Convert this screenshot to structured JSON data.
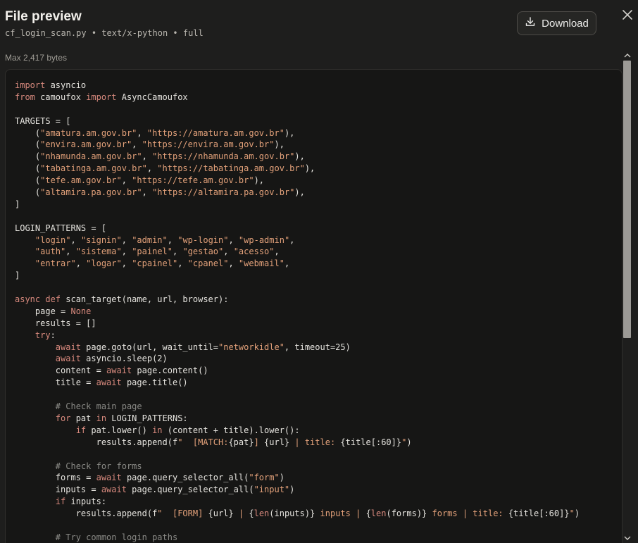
{
  "header": {
    "title": "File preview",
    "subtitle": "cf_login_scan.py • text/x-python • full",
    "download_label": "Download",
    "max_bytes": "Max 2,417 bytes"
  },
  "icons": {
    "download": "download-icon",
    "close": "close-icon"
  },
  "colors": {
    "keyword": "#d98a7e",
    "string": "#e3a17a",
    "comment": "#8a8a86",
    "text": "#e6e4df"
  },
  "code_lines": [
    [
      [
        "kw",
        "import"
      ],
      [
        "t",
        " asyncio"
      ]
    ],
    [
      [
        "kw",
        "from"
      ],
      [
        "t",
        " camoufox "
      ],
      [
        "kw",
        "import"
      ],
      [
        "t",
        " AsyncCamoufox"
      ]
    ],
    [],
    [
      [
        "t",
        "TARGETS = ["
      ]
    ],
    [
      [
        "t",
        "    ("
      ],
      [
        "str",
        "\"amatura.am.gov.br\""
      ],
      [
        "t",
        ", "
      ],
      [
        "str",
        "\"https://amatura.am.gov.br\""
      ],
      [
        "t",
        "),"
      ]
    ],
    [
      [
        "t",
        "    ("
      ],
      [
        "str",
        "\"envira.am.gov.br\""
      ],
      [
        "t",
        ", "
      ],
      [
        "str",
        "\"https://envira.am.gov.br\""
      ],
      [
        "t",
        "),"
      ]
    ],
    [
      [
        "t",
        "    ("
      ],
      [
        "str",
        "\"nhamunda.am.gov.br\""
      ],
      [
        "t",
        ", "
      ],
      [
        "str",
        "\"https://nhamunda.am.gov.br\""
      ],
      [
        "t",
        "),"
      ]
    ],
    [
      [
        "t",
        "    ("
      ],
      [
        "str",
        "\"tabatinga.am.gov.br\""
      ],
      [
        "t",
        ", "
      ],
      [
        "str",
        "\"https://tabatinga.am.gov.br\""
      ],
      [
        "t",
        "),"
      ]
    ],
    [
      [
        "t",
        "    ("
      ],
      [
        "str",
        "\"tefe.am.gov.br\""
      ],
      [
        "t",
        ", "
      ],
      [
        "str",
        "\"https://tefe.am.gov.br\""
      ],
      [
        "t",
        "),"
      ]
    ],
    [
      [
        "t",
        "    ("
      ],
      [
        "str",
        "\"altamira.pa.gov.br\""
      ],
      [
        "t",
        ", "
      ],
      [
        "str",
        "\"https://altamira.pa.gov.br\""
      ],
      [
        "t",
        "),"
      ]
    ],
    [
      [
        "t",
        "]"
      ]
    ],
    [],
    [
      [
        "t",
        "LOGIN_PATTERNS = ["
      ]
    ],
    [
      [
        "t",
        "    "
      ],
      [
        "str",
        "\"login\""
      ],
      [
        "t",
        ", "
      ],
      [
        "str",
        "\"signin\""
      ],
      [
        "t",
        ", "
      ],
      [
        "str",
        "\"admin\""
      ],
      [
        "t",
        ", "
      ],
      [
        "str",
        "\"wp-login\""
      ],
      [
        "t",
        ", "
      ],
      [
        "str",
        "\"wp-admin\""
      ],
      [
        "t",
        ","
      ]
    ],
    [
      [
        "t",
        "    "
      ],
      [
        "str",
        "\"auth\""
      ],
      [
        "t",
        ", "
      ],
      [
        "str",
        "\"sistema\""
      ],
      [
        "t",
        ", "
      ],
      [
        "str",
        "\"painel\""
      ],
      [
        "t",
        ", "
      ],
      [
        "str",
        "\"gestao\""
      ],
      [
        "t",
        ", "
      ],
      [
        "str",
        "\"acesso\""
      ],
      [
        "t",
        ","
      ]
    ],
    [
      [
        "t",
        "    "
      ],
      [
        "str",
        "\"entrar\""
      ],
      [
        "t",
        ", "
      ],
      [
        "str",
        "\"logar\""
      ],
      [
        "t",
        ", "
      ],
      [
        "str",
        "\"cpainel\""
      ],
      [
        "t",
        ", "
      ],
      [
        "str",
        "\"cpanel\""
      ],
      [
        "t",
        ", "
      ],
      [
        "str",
        "\"webmail\""
      ],
      [
        "t",
        ","
      ]
    ],
    [
      [
        "t",
        "]"
      ]
    ],
    [],
    [
      [
        "kw",
        "async def"
      ],
      [
        "t",
        " scan_target(name, url, browser):"
      ]
    ],
    [
      [
        "t",
        "    page = "
      ],
      [
        "kw",
        "None"
      ]
    ],
    [
      [
        "t",
        "    results = []"
      ]
    ],
    [
      [
        "t",
        "    "
      ],
      [
        "kw",
        "try"
      ],
      [
        "t",
        ":"
      ]
    ],
    [
      [
        "t",
        "        "
      ],
      [
        "kw",
        "await"
      ],
      [
        "t",
        " page.goto(url, wait_until="
      ],
      [
        "str",
        "\"networkidle\""
      ],
      [
        "t",
        ", timeout=25)"
      ]
    ],
    [
      [
        "t",
        "        "
      ],
      [
        "kw",
        "await"
      ],
      [
        "t",
        " asyncio.sleep(2)"
      ]
    ],
    [
      [
        "t",
        "        content = "
      ],
      [
        "kw",
        "await"
      ],
      [
        "t",
        " page.content()"
      ]
    ],
    [
      [
        "t",
        "        title = "
      ],
      [
        "kw",
        "await"
      ],
      [
        "t",
        " page.title()"
      ]
    ],
    [],
    [
      [
        "t",
        "        "
      ],
      [
        "cm",
        "# Check main page"
      ]
    ],
    [
      [
        "t",
        "        "
      ],
      [
        "kw",
        "for"
      ],
      [
        "t",
        " pat "
      ],
      [
        "kw",
        "in"
      ],
      [
        "t",
        " LOGIN_PATTERNS:"
      ]
    ],
    [
      [
        "t",
        "            "
      ],
      [
        "kw",
        "if"
      ],
      [
        "t",
        " pat.lower() "
      ],
      [
        "kw",
        "in"
      ],
      [
        "t",
        " (content + title).lower():"
      ]
    ],
    [
      [
        "t",
        "                results.append(f"
      ],
      [
        "str",
        "\"  [MATCH:"
      ],
      [
        "t",
        "{pat}"
      ],
      [
        "str",
        "] "
      ],
      [
        "t",
        "{url}"
      ],
      [
        "str",
        " | title: "
      ],
      [
        "t",
        "{title[:60]}"
      ],
      [
        "str",
        "\""
      ],
      [
        "t",
        ")"
      ]
    ],
    [],
    [
      [
        "t",
        "        "
      ],
      [
        "cm",
        "# Check for forms"
      ]
    ],
    [
      [
        "t",
        "        forms = "
      ],
      [
        "kw",
        "await"
      ],
      [
        "t",
        " page.query_selector_all("
      ],
      [
        "str",
        "\"form\""
      ],
      [
        "t",
        ")"
      ]
    ],
    [
      [
        "t",
        "        inputs = "
      ],
      [
        "kw",
        "await"
      ],
      [
        "t",
        " page.query_selector_all("
      ],
      [
        "str",
        "\"input\""
      ],
      [
        "t",
        ")"
      ]
    ],
    [
      [
        "t",
        "        "
      ],
      [
        "kw",
        "if"
      ],
      [
        "t",
        " inputs:"
      ]
    ],
    [
      [
        "t",
        "            results.append(f"
      ],
      [
        "str",
        "\"  [FORM] "
      ],
      [
        "t",
        "{url}"
      ],
      [
        "str",
        " | "
      ],
      [
        "t",
        "{"
      ],
      [
        "bi",
        "len"
      ],
      [
        "t",
        "(inputs)}"
      ],
      [
        "str",
        " inputs | "
      ],
      [
        "t",
        "{"
      ],
      [
        "bi",
        "len"
      ],
      [
        "t",
        "(forms)}"
      ],
      [
        "str",
        " forms | title: "
      ],
      [
        "t",
        "{title[:60]}"
      ],
      [
        "str",
        "\""
      ],
      [
        "t",
        ")"
      ]
    ],
    [],
    [
      [
        "t",
        "        "
      ],
      [
        "cm",
        "# Try common login paths"
      ]
    ]
  ]
}
